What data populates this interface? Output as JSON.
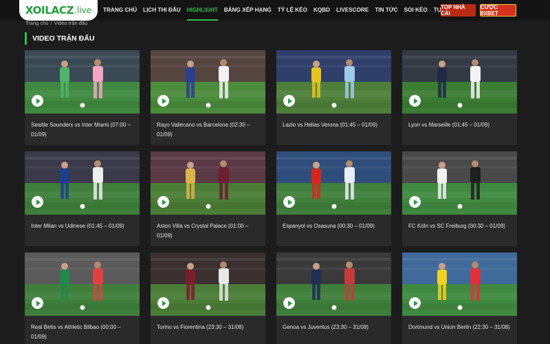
{
  "logo": {
    "main": "XOILACZ",
    "sub": ".live"
  },
  "nav": [
    {
      "label": "TRANG CHỦ",
      "active": false
    },
    {
      "label": "LỊCH THI ĐẤU",
      "active": false
    },
    {
      "label": "HIGHLIGHT",
      "active": true
    },
    {
      "label": "BẢNG XẾP HẠNG",
      "active": false
    },
    {
      "label": "TỶ LỆ KÈO",
      "active": false
    },
    {
      "label": "KQBD",
      "active": false
    },
    {
      "label": "LIVESCORE",
      "active": false
    },
    {
      "label": "TIN TỨC",
      "active": false
    },
    {
      "label": "SOI KÈO",
      "active": false
    },
    {
      "label": "TUYỂN DỤNG",
      "active": false
    }
  ],
  "buttons": {
    "top_label": "TOP NHÀ CÁI",
    "bet_label": "CƯỢC 8XBET"
  },
  "breadcrumb": {
    "home": "Trang chủ",
    "separator": "/",
    "current": "Video trận đấu"
  },
  "section": {
    "title": "VIDEO TRẬN ĐẤU"
  },
  "videos": [
    {
      "title": "Seattle Sounders vs Inter Miami (07:00 – 01/09)",
      "kitA": "#4fb36a",
      "kitB": "#f3a5c3",
      "pitch": "#3f8a40",
      "stand": "#3a4a55"
    },
    {
      "title": "Rayo Vallecano vs Barcelona (02:30 – 01/09)",
      "kitA": "#2b3f8c",
      "kitB": "#f2f2f2",
      "pitch": "#4a8b3c",
      "stand": "#55453f"
    },
    {
      "title": "Lazio vs Hellas Verona (01:45 – 01/09)",
      "kitA": "#e8c51e",
      "kitB": "#9fcbe8",
      "pitch": "#4d7f3a",
      "stand": "#2f3f6a"
    },
    {
      "title": "Lyon vs Marseille (01:45 – 01/09)",
      "kitA": "#1f2b45",
      "kitB": "#f3f3f3",
      "pitch": "#3c7d34",
      "stand": "#333a44"
    },
    {
      "title": "Inter Milan vs Udinese (01:45 – 01/09)",
      "kitA": "#1d3f8a",
      "kitB": "#ededed",
      "pitch": "#3f7f3b",
      "stand": "#3a3a4a"
    },
    {
      "title": "Aston Villa vs Crystal Palace (01:00 – 01/09)",
      "kitA": "#d9b44a",
      "kitB": "#6b1f2f",
      "pitch": "#4b7d36",
      "stand": "#5a3a45"
    },
    {
      "title": "Espanyol vs Osasuna (00:30 – 01/09)",
      "kitA": "#d9261c",
      "kitB": "#e8eef7",
      "pitch": "#3f7f3b",
      "stand": "#2f4d7a"
    },
    {
      "title": "FC Köln vs SC Freiburg (00:30 – 01/09)",
      "kitA": "#f2f2f2",
      "kitB": "#1e1e1e",
      "pitch": "#3f8a40",
      "stand": "#4a4a4a"
    },
    {
      "title": "Real Betis vs Athletic Bilbao (00:00 – 01/09)",
      "kitA": "#1f8a4a",
      "kitB": "#e04040",
      "pitch": "#3f7f3b",
      "stand": "#5a5a5a"
    },
    {
      "title": "Torino vs Fiorentina (23:30 – 31/08)",
      "kitA": "#7a1f2a",
      "kitB": "#e8e8e8",
      "pitch": "#4a7d36",
      "stand": "#3a3030"
    },
    {
      "title": "Genoa vs Juventus (23:30 – 31/08)",
      "kitA": "#1f2f55",
      "kitB": "#c73a3a",
      "pitch": "#3f7f3b",
      "stand": "#3a3a3a"
    },
    {
      "title": "Dortmund vs Union Berlin (22:30 – 31/08)",
      "kitA": "#f2d21e",
      "kitB": "#e0303a",
      "pitch": "#3f8a40",
      "stand": "#3f6a9a"
    }
  ]
}
